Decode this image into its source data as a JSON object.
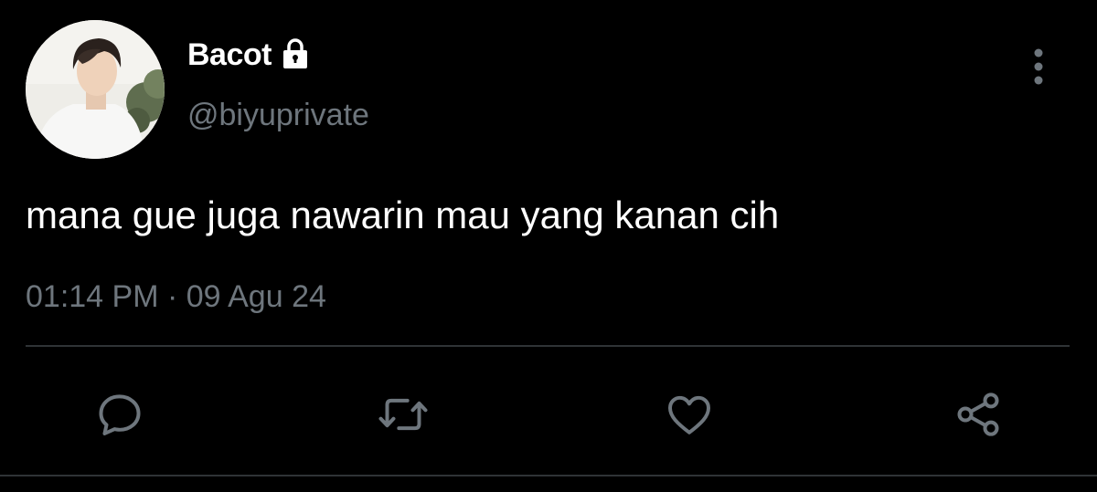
{
  "tweet": {
    "display_name": "Bacot",
    "handle": "@biyuprivate",
    "text": "mana gue juga nawarin mau yang kanan cih",
    "time": "01:14 PM",
    "separator": "·",
    "date": "09 Agu 24",
    "meta": "01:14 PM · 09 Agu 24"
  },
  "icons": {
    "lock": "lock-icon",
    "more": "more-vertical-icon",
    "reply": "reply-icon",
    "retweet": "retweet-icon",
    "like": "heart-icon",
    "share": "share-icon"
  },
  "colors": {
    "background": "#000000",
    "primary_text": "#ffffff",
    "secondary_text": "#6e767d",
    "divider": "#2f3336"
  }
}
